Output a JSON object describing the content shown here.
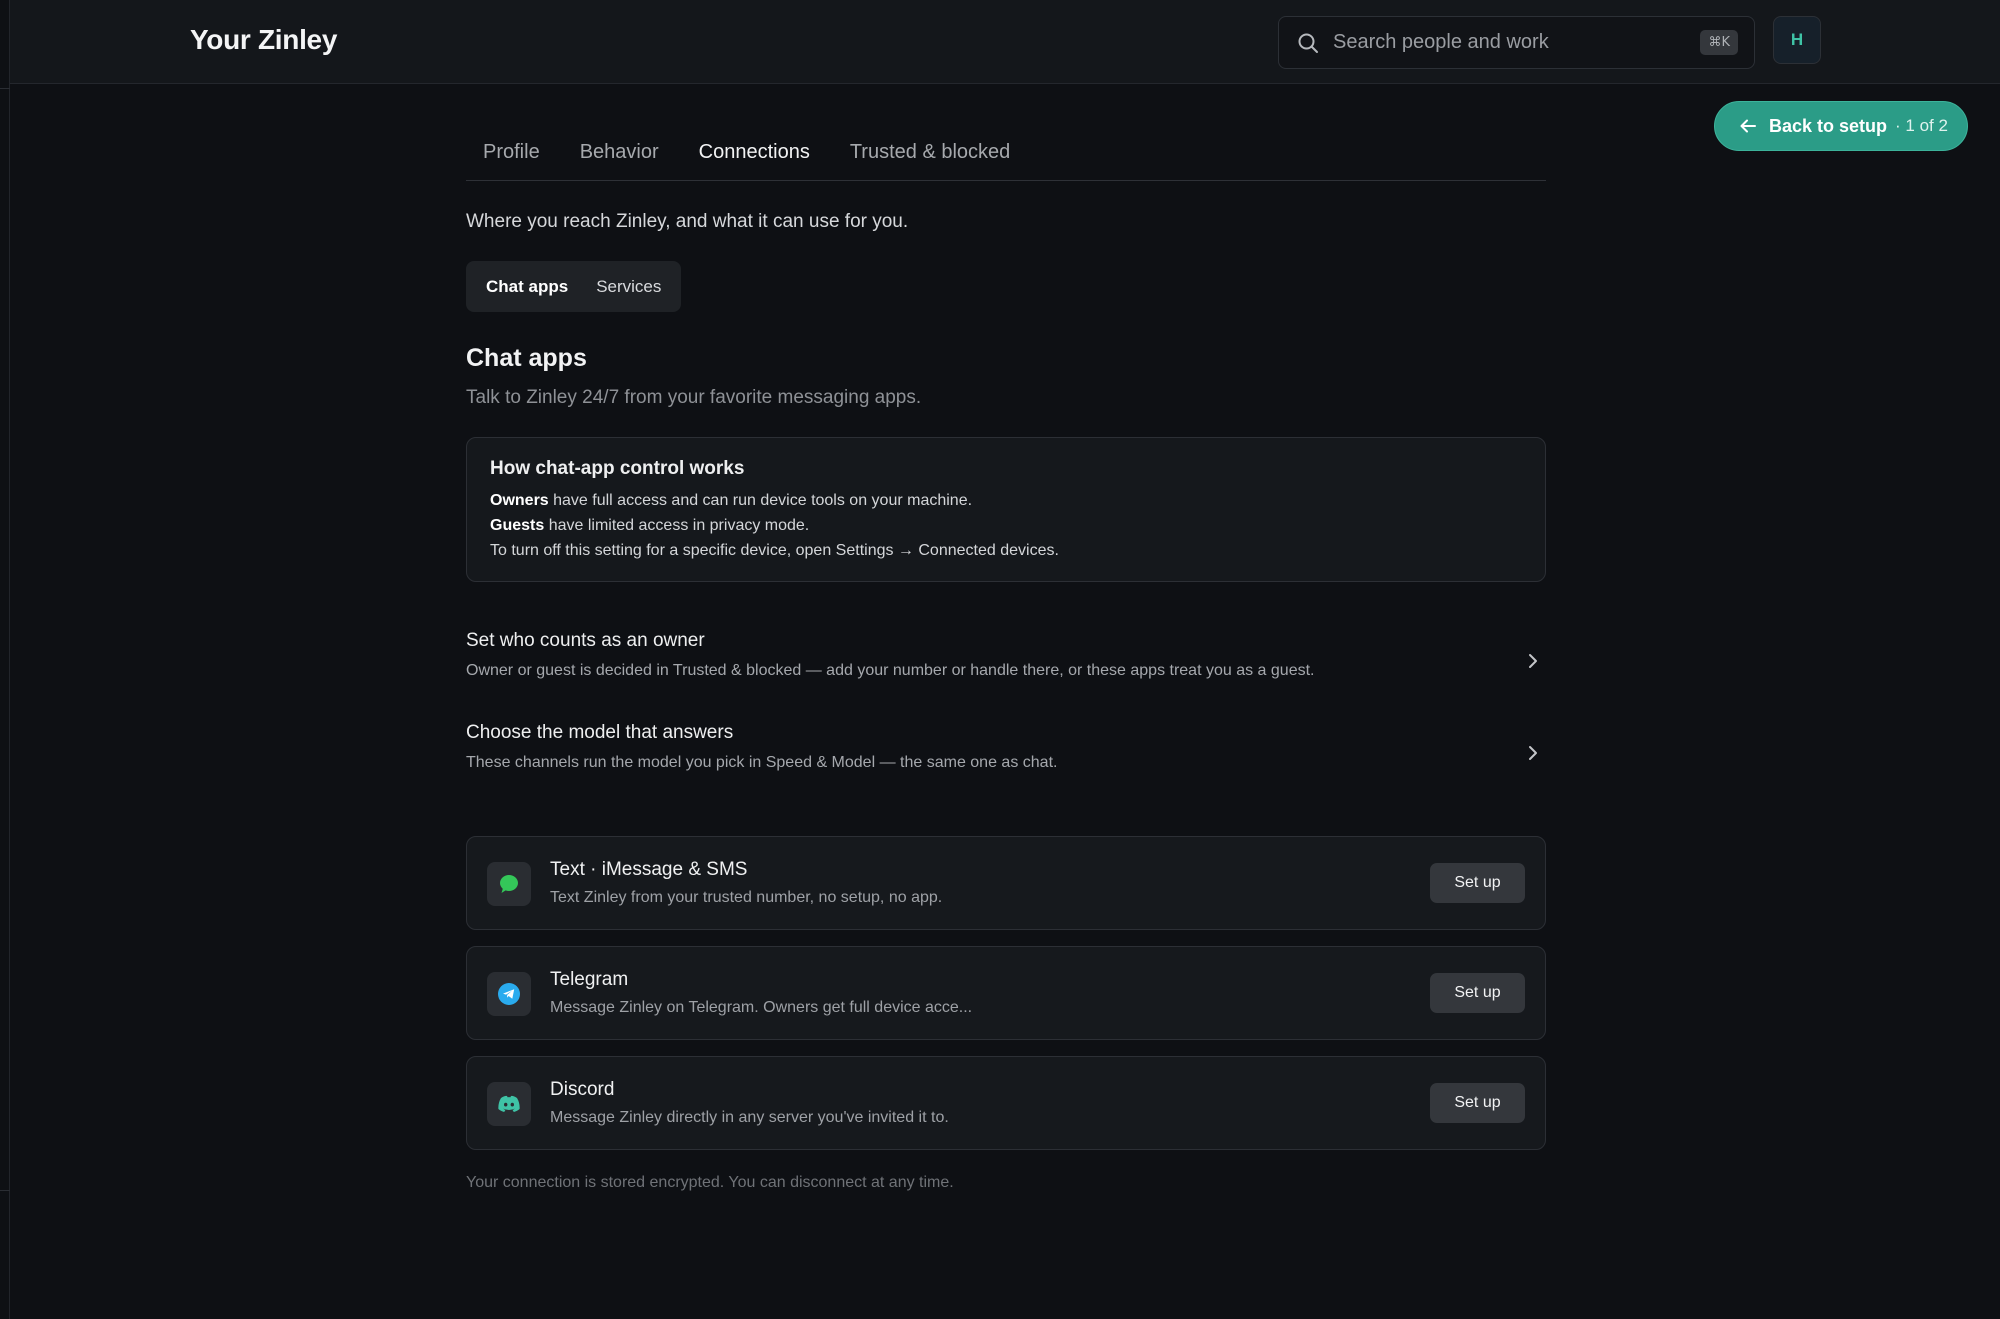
{
  "header": {
    "title": "Your Zinley",
    "search_placeholder": "Search people and work",
    "search_shortcut": "⌘K",
    "avatar_initial": "H"
  },
  "setup_nav": {
    "back_label": "Back to setup",
    "step": "· 1 of 2"
  },
  "tabs": [
    {
      "label": "Profile",
      "active": false
    },
    {
      "label": "Behavior",
      "active": false
    },
    {
      "label": "Connections",
      "active": true
    },
    {
      "label": "Trusted & blocked",
      "active": false
    }
  ],
  "tagline": "Where you reach Zinley, and what it can use for you.",
  "segments": [
    {
      "label": "Chat apps",
      "active": true
    },
    {
      "label": "Services",
      "active": false
    }
  ],
  "section": {
    "title": "Chat apps",
    "subtitle": "Talk to Zinley 24/7 from your favorite messaging apps."
  },
  "info_box": {
    "title": "How chat-app control works",
    "owners_label": "Owners",
    "owners_text": " have full access and can run device tools on your machine.",
    "guests_label": "Guests",
    "guests_text": " have limited access in privacy mode.",
    "device_text": "To turn off this setting for a specific device, open Settings → Connected devices."
  },
  "settings_rows": [
    {
      "title": "Set who counts as an owner",
      "description": "Owner or guest is decided in Trusted & blocked — add your number or handle there, or these apps treat you as a guest."
    },
    {
      "title": "Choose the model that answers",
      "description": "These channels run the model you pick in Speed & Model — the same one as chat."
    }
  ],
  "chat_apps": [
    {
      "name": "Text · iMessage & SMS",
      "description": "Text Zinley from your trusted number, no setup, no app.",
      "button": "Set up",
      "icon": "message-bubble-icon",
      "icon_color": "#34c759"
    },
    {
      "name": "Telegram",
      "description": "Message Zinley on Telegram. Owners get full device acce...",
      "button": "Set up",
      "icon": "telegram-icon",
      "icon_color": "#2aabee"
    },
    {
      "name": "Discord",
      "description": "Message Zinley directly in any server you've invited it to.",
      "button": "Set up",
      "icon": "discord-icon",
      "icon_color": "#3fc3a6"
    }
  ],
  "footnote": "Your connection is stored encrypted. You can disconnect at any time.",
  "colors": {
    "accent": "#2b9c87",
    "background": "#0e1014",
    "card": "#16191d"
  }
}
